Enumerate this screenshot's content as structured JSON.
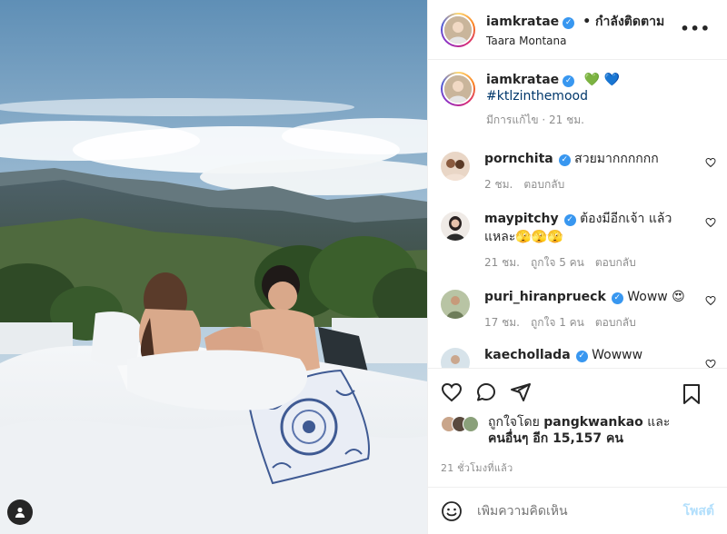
{
  "post": {
    "username": "iamkratae",
    "follow_label": "• กำลังติดตาม",
    "location": "Taara Montana",
    "more_label": "•••",
    "verified_glyph": "✓"
  },
  "caption": {
    "username": "iamkratae",
    "emojis": "💚 💙",
    "hashtag": "#ktlzinthemood",
    "meta": "มีการแก้ไข · 21 ชม."
  },
  "comments": [
    {
      "username": "pornchita",
      "text": "สวยมากกกกกก",
      "time": "2 ชม.",
      "likes": "",
      "reply": "ตอบกลับ",
      "avatar_color": "#d8b8a0"
    },
    {
      "username": "maypitchy",
      "text": "ต้องมีอีกเจ้า แล้วแหละ🫣🫣🫣",
      "time": "21 ชม.",
      "likes": "ถูกใจ 5 คน",
      "reply": "ตอบกลับ",
      "avatar_color": "#3a3a3a"
    },
    {
      "username": "puri_hiranprueck",
      "text": "Woww 😍",
      "time": "17 ชม.",
      "likes": "ถูกใจ 1 คน",
      "reply": "ตอบกลับ",
      "avatar_color": "#8a9a70"
    },
    {
      "username": "kaechollada",
      "text": "Wowww",
      "time": "",
      "likes": "",
      "reply": "",
      "avatar_color": "#b7ccd6"
    }
  ],
  "likes": {
    "prefix": "ถูกใจโดย",
    "user": "pangkwankao",
    "suffix": "และ",
    "others": "คนอื่นๆ อีก 15,157 คน"
  },
  "timestamp": "21 ชั่วโมงที่แล้ว",
  "comment_box": {
    "placeholder": "เพิ่มความคิดเห็น",
    "post_label": "โพสต์"
  },
  "icons": {
    "like": "heart-icon",
    "comment": "comment-icon",
    "share": "share-icon",
    "save": "bookmark-icon",
    "emoji": "emoji-icon",
    "tag": "user-tag-icon"
  },
  "colors": {
    "verified": "#3897f0",
    "hashtag": "#00376b",
    "post_button": "#b2dffc",
    "muted": "#8e8e8e"
  }
}
